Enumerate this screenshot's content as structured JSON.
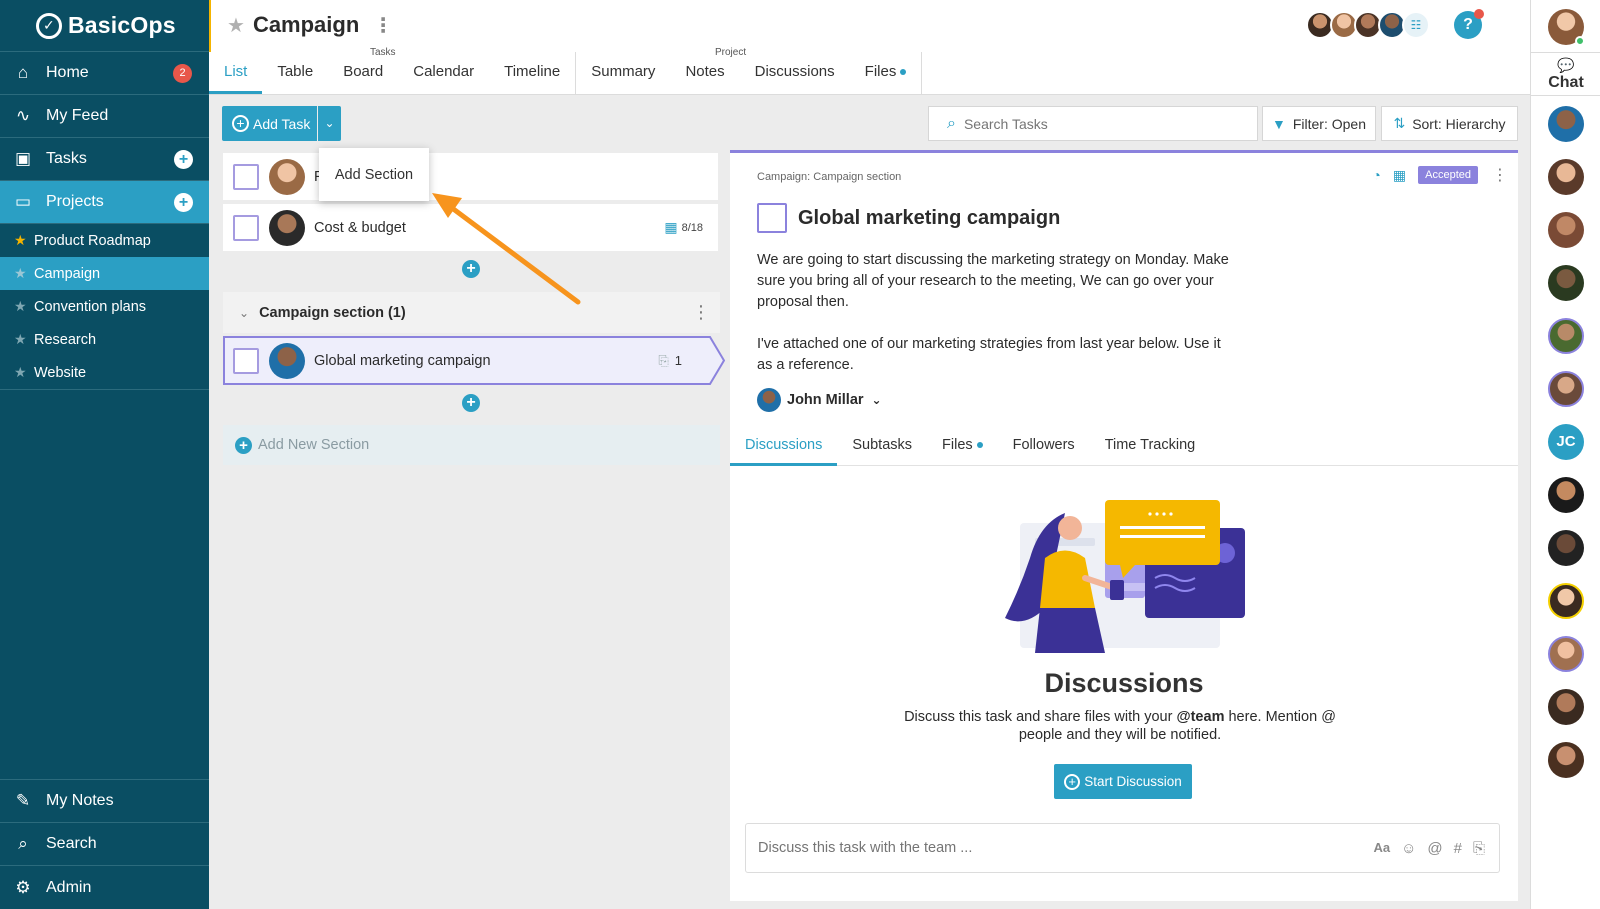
{
  "brand": {
    "name": "BasicOps"
  },
  "sidebar": {
    "nav": [
      {
        "label": "Home",
        "icon": "home-icon",
        "badge": "2"
      },
      {
        "label": "My Feed",
        "icon": "feed-icon"
      },
      {
        "label": "Tasks",
        "icon": "clipboard-icon"
      },
      {
        "label": "Projects",
        "icon": "folder-icon"
      }
    ],
    "projects": [
      {
        "label": "Product Roadmap",
        "favorite": true
      },
      {
        "label": "Campaign",
        "active": true
      },
      {
        "label": "Convention plans"
      },
      {
        "label": "Research"
      },
      {
        "label": "Website"
      }
    ],
    "bottom": [
      {
        "label": "My Notes",
        "icon": "pencil-icon"
      },
      {
        "label": "Search",
        "icon": "search-icon"
      },
      {
        "label": "Admin",
        "icon": "gear-icon"
      }
    ]
  },
  "header": {
    "title": "Campaign",
    "group_tasks": "Tasks",
    "group_project": "Project",
    "tabs": [
      "List",
      "Table",
      "Board",
      "Calendar",
      "Timeline",
      "Summary",
      "Notes",
      "Discussions",
      "Files"
    ]
  },
  "chat": {
    "label": "Chat",
    "initials": "JC"
  },
  "toolbar": {
    "add_task": "Add Task",
    "search_placeholder": "Search Tasks",
    "filter": "Filter: Open",
    "sort": "Sort: Hierarchy"
  },
  "popup": {
    "add_section": "Add Section"
  },
  "tasks": {
    "row1": {
      "title_prefix": "F"
    },
    "row2": {
      "title": "Cost & budget",
      "date": "8/18"
    },
    "section": {
      "title": "Campaign section (1)"
    },
    "selected": {
      "title": "Global marketing campaign",
      "attachments": "1"
    },
    "add_new_section": "Add New Section"
  },
  "detail": {
    "breadcrumb": "Campaign: Campaign section",
    "status": "Accepted",
    "title": "Global marketing campaign",
    "desc_p1": "We are going to start discussing the marketing strategy on Monday. Make sure you bring all of your research to the meeting, We can go over your proposal then.",
    "desc_p2": "I've attached one of our marketing strategies from last year below. Use it as a reference.",
    "assignee": "John Millar",
    "tabs": [
      "Discussions",
      "Subtasks",
      "Files",
      "Followers",
      "Time Tracking"
    ],
    "empty_title": "Discussions",
    "empty_text_1": "Discuss this task and share files with your ",
    "empty_text_bold": "@team",
    "empty_text_2": " here. Mention @ people and they will be notified.",
    "start_button": "Start Discussion",
    "comment_placeholder": "Discuss this task with the team ...",
    "comment_tools": [
      "Aa",
      "☺",
      "@",
      "#",
      "⎘"
    ]
  },
  "colors": {
    "sidebar": "#0a4e63",
    "accent": "#2b9fc4",
    "purple": "#8b82dd",
    "badge": "#e8574a",
    "arrow": "#f7941d"
  }
}
